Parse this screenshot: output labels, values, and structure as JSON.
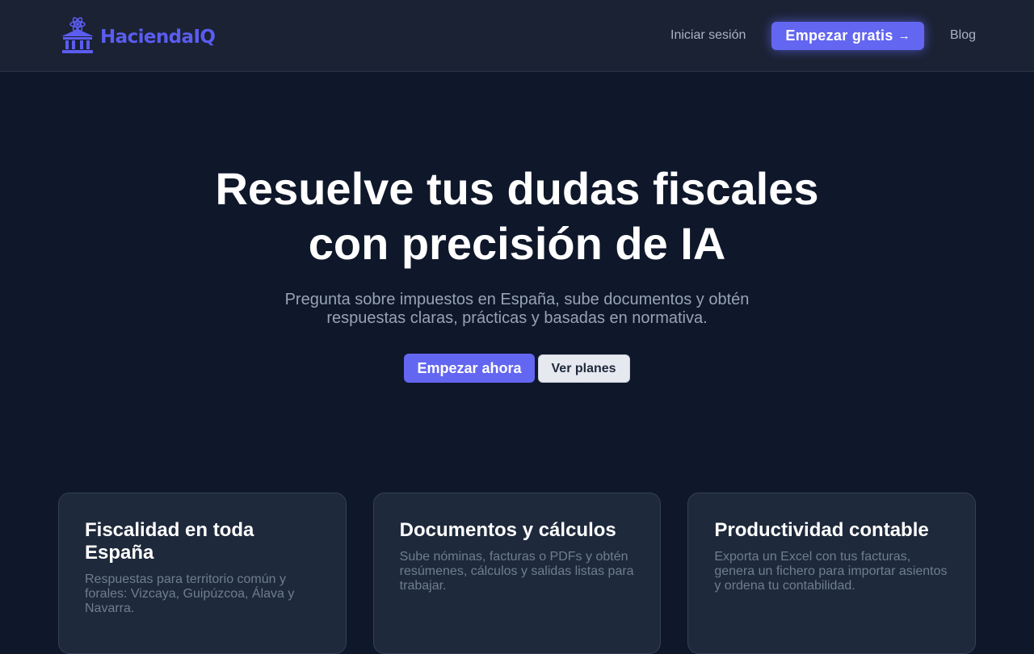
{
  "brand": {
    "name": "HaciendaIQ",
    "logo_icon": "bank-atom-icon",
    "accent": "#6366f1"
  },
  "nav": {
    "login": "Iniciar sesión",
    "cta": "Empezar gratis",
    "cta_arrow": "→",
    "blog": "Blog"
  },
  "hero": {
    "title_line1": "Resuelve tus dudas fiscales",
    "title_line2": "con precisión de IA",
    "subtitle": "Pregunta sobre impuestos en España, sube documentos y obtén respuestas claras, prácticas y basadas en normativa.",
    "primary_button": "Empezar ahora",
    "secondary_button": "Ver planes"
  },
  "features": [
    {
      "title": "Fiscalidad en toda España",
      "description": "Respuestas para territorio común y forales: Vizcaya, Guipúzcoa, Álava y Navarra."
    },
    {
      "title": "Documentos y cálculos",
      "description": "Sube nóminas, facturas o PDFs y obtén resúmenes, cálculos y salidas listas para trabajar."
    },
    {
      "title": "Productividad contable",
      "description": "Exporta un Excel con tus facturas, genera un fichero para importar asientos y ordena tu contabilidad."
    }
  ]
}
